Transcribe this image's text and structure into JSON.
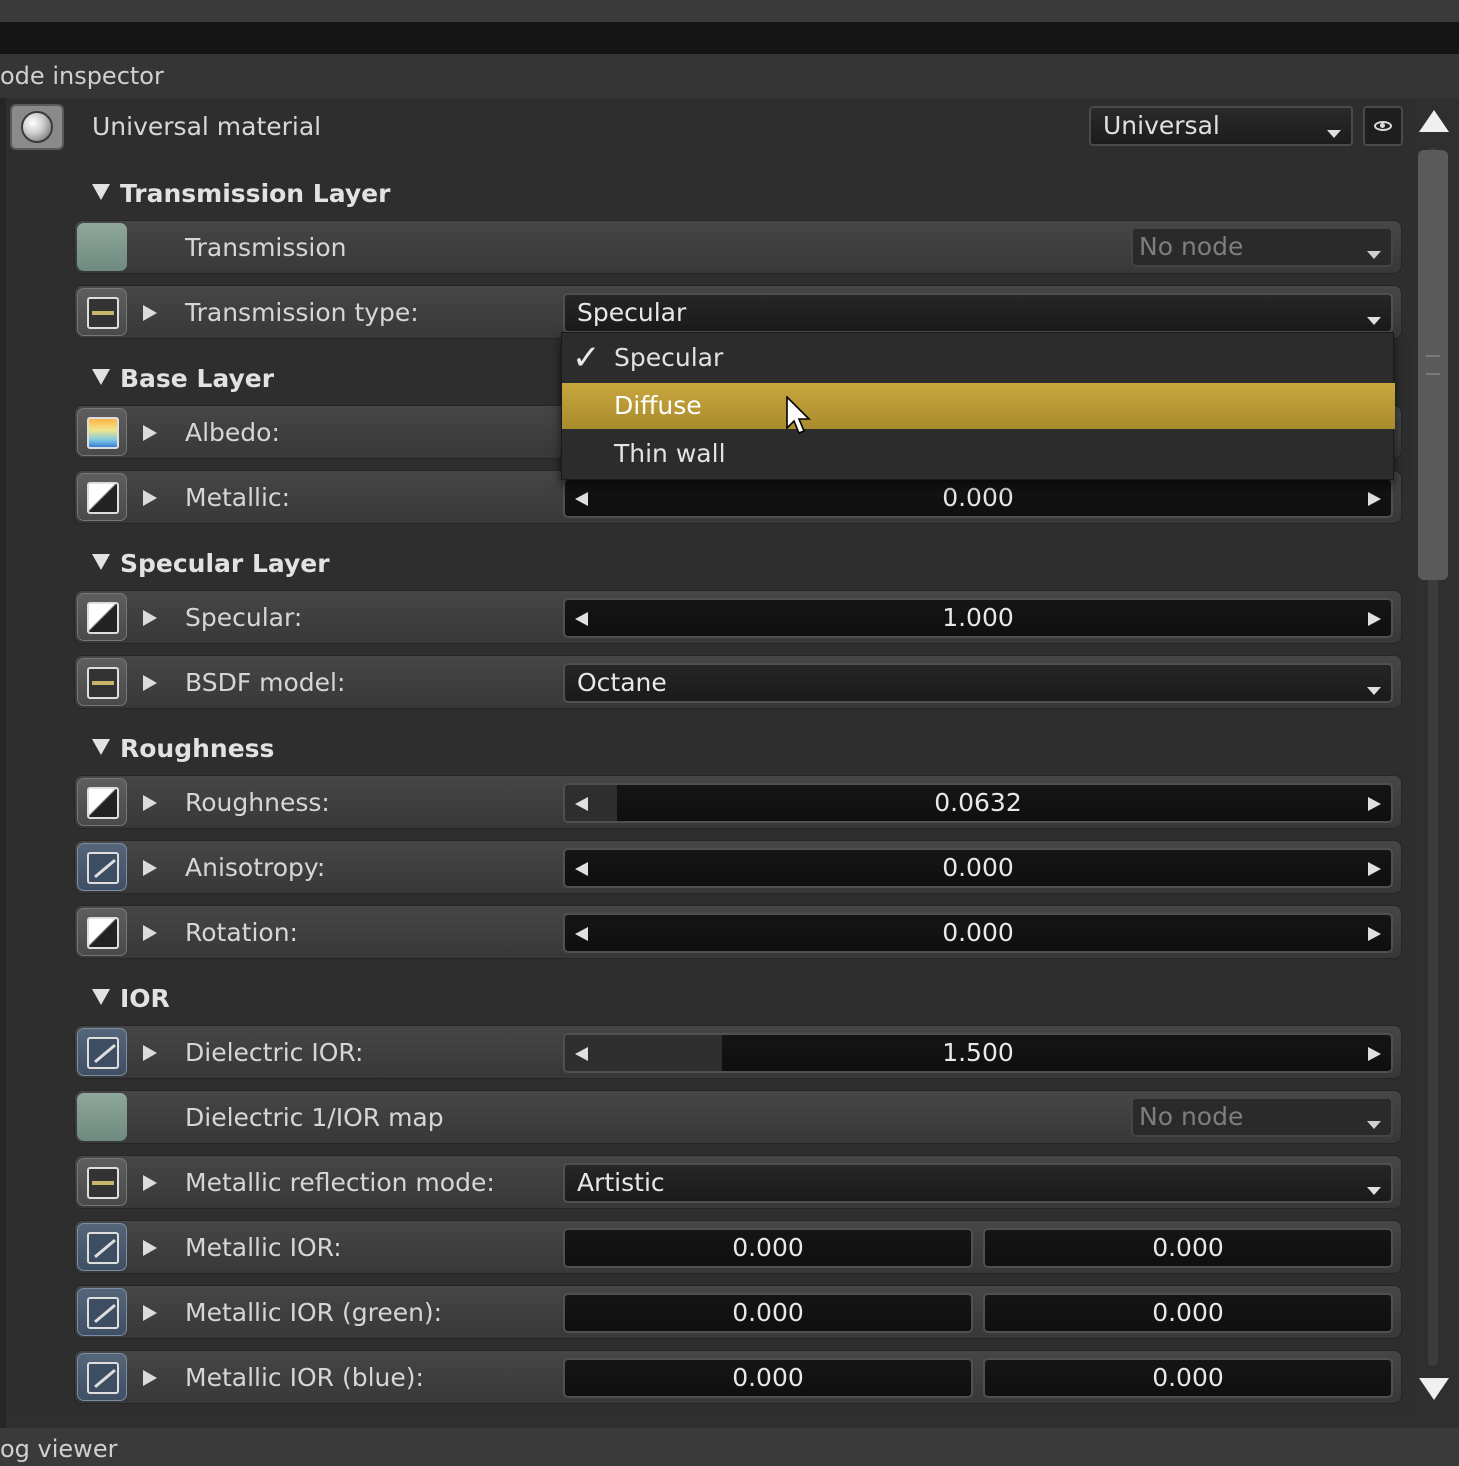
{
  "window": {
    "panel_title": "ode inspector",
    "bottom_panel_title": "og viewer"
  },
  "header": {
    "material_name": "Universal material",
    "type_combo": "Universal"
  },
  "sections": {
    "transmission": "Transmission Layer",
    "base": "Base Layer",
    "specular": "Specular Layer",
    "roughness": "Roughness",
    "ior": "IOR"
  },
  "rows": {
    "transmission": {
      "label": "Transmission",
      "node": "No node"
    },
    "transmission_type": {
      "label": "Transmission type:",
      "value": "Specular"
    },
    "albedo": {
      "label": "Albedo:"
    },
    "metallic": {
      "label": "Metallic:",
      "value": "0.000"
    },
    "specular": {
      "label": "Specular:",
      "value": "1.000"
    },
    "bsdf_model": {
      "label": "BSDF model:",
      "value": "Octane"
    },
    "roughness": {
      "label": "Roughness:",
      "value": "0.0632",
      "fill": 0.0632
    },
    "anisotropy": {
      "label": "Anisotropy:",
      "value": "0.000"
    },
    "rotation": {
      "label": "Rotation:",
      "value": "0.000"
    },
    "dielectric_ior": {
      "label": "Dielectric IOR:",
      "value": "1.500",
      "fill": 0.19
    },
    "dielectric_map": {
      "label": "Dielectric 1/IOR map",
      "node": "No node"
    },
    "metallic_reflection_mode": {
      "label": "Metallic reflection mode:",
      "value": "Artistic"
    },
    "metallic_ior": {
      "label": "Metallic IOR:",
      "value1": "0.000",
      "value2": "0.000"
    },
    "metallic_ior_green": {
      "label": "Metallic IOR (green):",
      "value1": "0.000",
      "value2": "0.000"
    },
    "metallic_ior_blue": {
      "label": "Metallic IOR (blue):",
      "value1": "0.000",
      "value2": "0.000"
    }
  },
  "dropdown_popup": {
    "options": [
      "Specular",
      "Diffuse",
      "Thin wall"
    ],
    "checked": "Specular",
    "highlighted": "Diffuse",
    "check_glyph": "✓"
  },
  "colors": {
    "highlight": "#b8982f",
    "pin_green": "#7f998c",
    "pin_blue": "#4c5c70"
  }
}
